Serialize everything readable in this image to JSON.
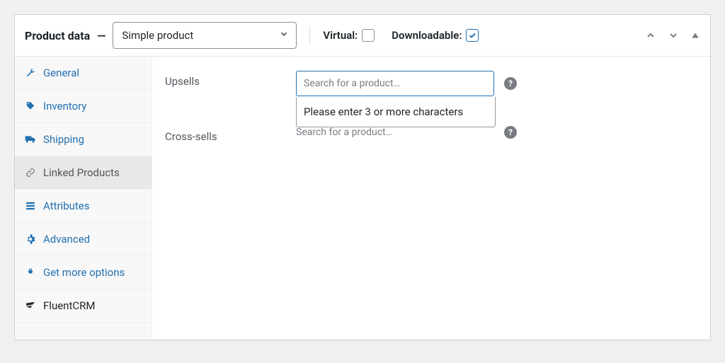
{
  "header": {
    "title": "Product data",
    "product_type": "Simple product",
    "virtual_label": "Virtual:",
    "virtual_checked": false,
    "downloadable_label": "Downloadable:",
    "downloadable_checked": true
  },
  "sidebar": {
    "tabs": [
      {
        "id": "general",
        "label": "General",
        "icon": "wrench-icon"
      },
      {
        "id": "inventory",
        "label": "Inventory",
        "icon": "tag-icon"
      },
      {
        "id": "shipping",
        "label": "Shipping",
        "icon": "truck-icon"
      },
      {
        "id": "linked",
        "label": "Linked Products",
        "icon": "link-icon",
        "active": true
      },
      {
        "id": "attributes",
        "label": "Attributes",
        "icon": "list-icon"
      },
      {
        "id": "advanced",
        "label": "Advanced",
        "icon": "gear-icon"
      },
      {
        "id": "getmore",
        "label": "Get more options",
        "icon": "plug-icon"
      },
      {
        "id": "fluentcrm",
        "label": "FluentCRM",
        "icon": "fluent-icon"
      }
    ]
  },
  "content": {
    "upsells": {
      "label": "Upsells",
      "placeholder": "Search for a product…",
      "dropdown_message": "Please enter 3 or more characters"
    },
    "crosssells": {
      "label": "Cross-sells",
      "placeholder": "Search for a product…"
    }
  }
}
